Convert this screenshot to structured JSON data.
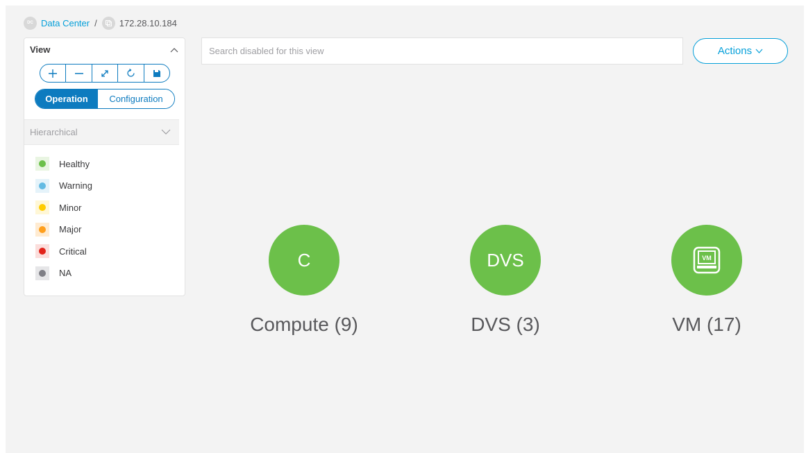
{
  "breadcrumb": {
    "root_icon_text": "DC",
    "root_label": "Data Center",
    "separator": "/",
    "current_label": "172.28.10.184"
  },
  "panel": {
    "title": "View",
    "toolbar": {
      "buttons": [
        "zoom-in-icon",
        "zoom-out-icon",
        "fit-to-screen-icon",
        "refresh-icon",
        "save-icon"
      ]
    },
    "modes": {
      "active": "Operation",
      "inactive": "Configuration"
    },
    "layout_select": {
      "value": "Hierarchical"
    },
    "legend": [
      {
        "label": "Healthy",
        "color": "#6cc04a",
        "bg": "#e9f5e2"
      },
      {
        "label": "Warning",
        "color": "#64bbe3",
        "bg": "#e5f3fa"
      },
      {
        "label": "Minor",
        "color": "#ffcc00",
        "bg": "#fff7d6"
      },
      {
        "label": "Major",
        "color": "#ff9f1c",
        "bg": "#ffebd1"
      },
      {
        "label": "Critical",
        "color": "#e2231a",
        "bg": "#fbdedc"
      },
      {
        "label": "NA",
        "color": "#7f7f86",
        "bg": "#e6e6e8"
      }
    ]
  },
  "search": {
    "placeholder": "Search disabled for this view"
  },
  "actions": {
    "label": "Actions"
  },
  "nodes": [
    {
      "glyph": "C",
      "label": "Compute (9)"
    },
    {
      "glyph": "DVS",
      "label": "DVS (3)"
    },
    {
      "icon": "vm-icon",
      "icon_text": "VM",
      "label": "VM (17)"
    }
  ],
  "colors": {
    "accent": "#0d7bbf",
    "link": "#049fd9",
    "healthy": "#6cc04a"
  }
}
